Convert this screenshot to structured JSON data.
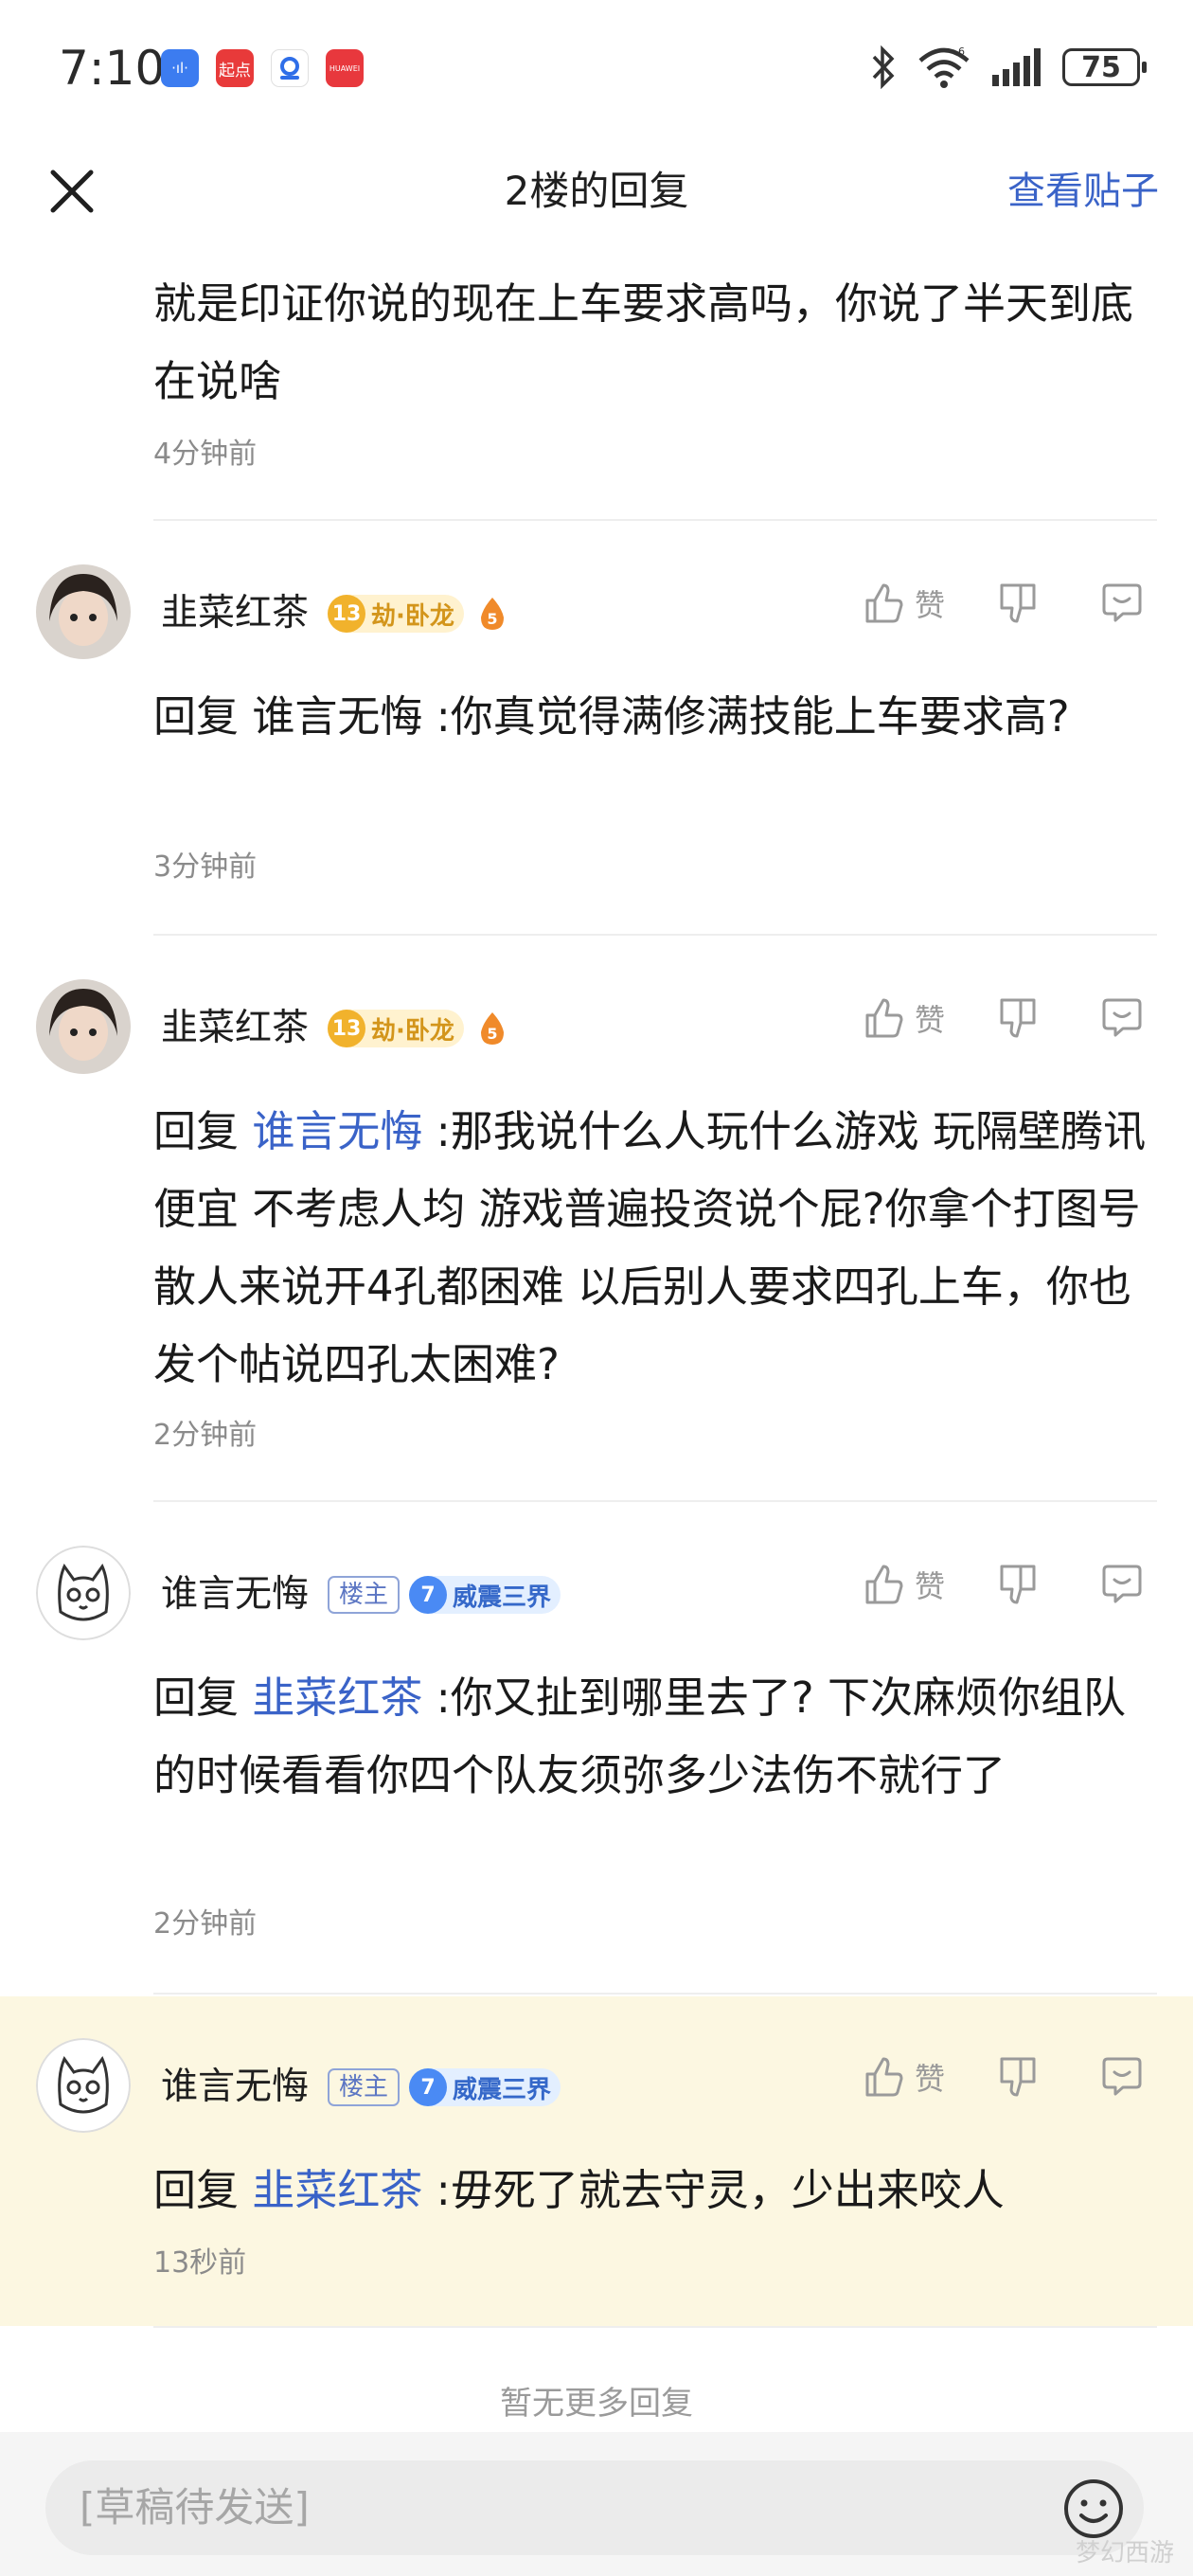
{
  "status_bar": {
    "time": "7:10",
    "app_icons": [
      {
        "name": "audio-app-icon",
        "label": "·ıl·",
        "color": "#3c7cf0"
      },
      {
        "name": "qidian-app-icon",
        "label": "起点",
        "color": "#e83a3a"
      },
      {
        "name": "tencent-app-icon",
        "label": "",
        "color": "#2f6ee8"
      },
      {
        "name": "huawei-app-icon",
        "label": "HUAWEI",
        "color": "#e8383d"
      }
    ],
    "battery": "75"
  },
  "header": {
    "title": "2楼的回复",
    "view_post": "查看贴子"
  },
  "comments": [
    {
      "text": "就是印证你说的现在上车要求高吗，你说了半天到底在说啥",
      "time": "4分钟前"
    },
    {
      "user": "韭菜红茶",
      "level": "13",
      "title": "劫·卧龙",
      "flame_level": "5",
      "like": "赞",
      "reply_prefix": "回复 ",
      "mention": "谁言无悔",
      "body": " :你真觉得满修满技能上车要求高?",
      "time": "3分钟前"
    },
    {
      "user": "韭菜红茶",
      "level": "13",
      "title": "劫·卧龙",
      "flame_level": "5",
      "like": "赞",
      "reply_prefix": "回复 ",
      "mention": "谁言无悔",
      "body": " :那我说什么人玩什么游戏 玩隔壁腾讯便宜 不考虑人均 游戏普遍投资说个屁?你拿个打图号散人来说开4孔都困难 以后别人要求四孔上车，你也发个帖说四孔太困难?",
      "time": "2分钟前"
    },
    {
      "user": "谁言无悔",
      "owner_tag": "楼主",
      "level": "7",
      "title": "威震三界",
      "like": "赞",
      "reply_prefix": "回复 ",
      "mention": "韭菜红茶",
      "body": " :你又扯到哪里去了? 下次麻烦你组队的时候看看你四个队友须弥多少法伤不就行了",
      "time": "2分钟前"
    },
    {
      "user": "谁言无悔",
      "owner_tag": "楼主",
      "level": "7",
      "title": "威震三界",
      "like": "赞",
      "reply_prefix": "回复 ",
      "mention": "韭菜红茶",
      "body": " :毋死了就去守灵，少出来咬人",
      "time": "13秒前"
    }
  ],
  "footer": {
    "no_more": "暂无更多回复",
    "input_placeholder": "[草稿待发送]",
    "watermark": "梦幻西游"
  },
  "colors": {
    "accent": "#3a63c8",
    "highlight": "#fcf7e1",
    "level_gold": "#f1b22c",
    "level_blue": "#4a8af4"
  }
}
